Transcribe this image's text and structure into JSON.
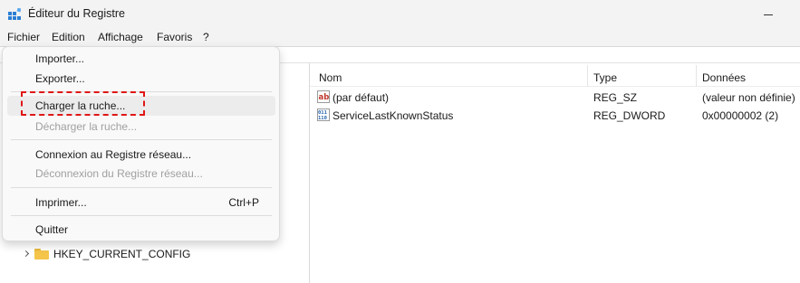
{
  "window": {
    "title": "Éditeur du Registre"
  },
  "menubar": {
    "items": [
      "Fichier",
      "Edition",
      "Affichage",
      "Favoris",
      "?"
    ]
  },
  "file_menu": {
    "importer": "Importer...",
    "exporter": "Exporter...",
    "charger_ruche": "Charger la ruche...",
    "decharger_ruche": "Décharger la ruche...",
    "connexion": "Connexion au Registre réseau...",
    "deconnexion": "Déconnexion du Registre réseau...",
    "imprimer": "Imprimer...",
    "imprimer_shortcut": "Ctrl+P",
    "quitter": "Quitter"
  },
  "tree": {
    "visible_key": "HKEY_CURRENT_CONFIG"
  },
  "list": {
    "columns": [
      "Nom",
      "Type",
      "Données"
    ],
    "rows": [
      {
        "name": "(par défaut)",
        "type": "REG_SZ",
        "data": "(valeur non définie)",
        "icon": "string-value-icon"
      },
      {
        "name": "ServiceLastKnownStatus",
        "type": "REG_DWORD",
        "data": "0x00000002 (2)",
        "icon": "binary-value-icon"
      }
    ]
  },
  "colors": {
    "highlight": "#e01616",
    "folder": "#f4c54a",
    "value_icon_red": "#c0392b",
    "value_icon_blue": "#1f5fa8"
  }
}
